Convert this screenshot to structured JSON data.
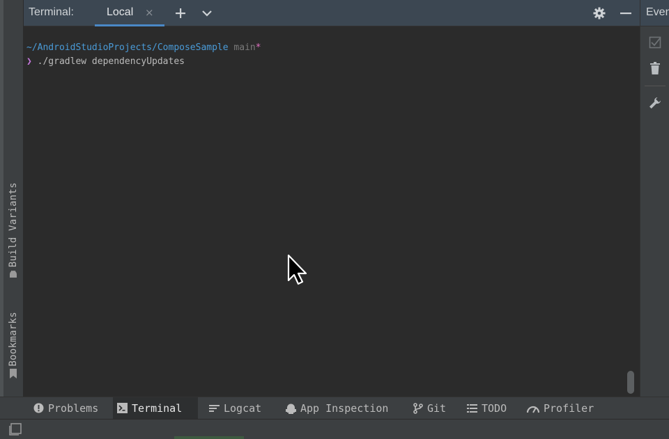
{
  "header": {
    "title": "Terminal:",
    "tab_label": "Local",
    "tab_close_glyph": "×"
  },
  "terminal": {
    "cwd": "~/AndroidStudioProjects/ComposeSample",
    "branch": "main",
    "dirty_marker": "*",
    "prompt_glyph": "❯",
    "command": "./gradlew dependencyUpdates"
  },
  "left_panel": {
    "tabs": [
      {
        "label": "Build Variants",
        "icon": "android-icon"
      },
      {
        "label": "Bookmarks",
        "icon": "bookmark-icon"
      }
    ]
  },
  "right_panel": {
    "title": "Event Log",
    "icons": [
      "checklist-icon",
      "trash-icon",
      "wrench-icon"
    ]
  },
  "bottom_tabs": [
    {
      "label": "Problems",
      "icon": "warning-circle-icon",
      "active": false
    },
    {
      "label": "Terminal",
      "icon": "terminal-icon",
      "active": true
    },
    {
      "label": "Logcat",
      "icon": "logcat-icon",
      "active": false
    },
    {
      "label": "App Inspection",
      "icon": "inspection-icon",
      "active": false
    },
    {
      "label": "Git",
      "icon": "git-branch-icon",
      "active": false
    },
    {
      "label": "TODO",
      "icon": "list-icon",
      "active": false
    },
    {
      "label": "Profiler",
      "icon": "gauge-icon",
      "active": false
    }
  ],
  "colors": {
    "accent": "#4a88c7",
    "path": "#4a9bd8",
    "prompt": "#c678dd",
    "dirty": "#e070c0",
    "background": "#2b2b2b"
  }
}
